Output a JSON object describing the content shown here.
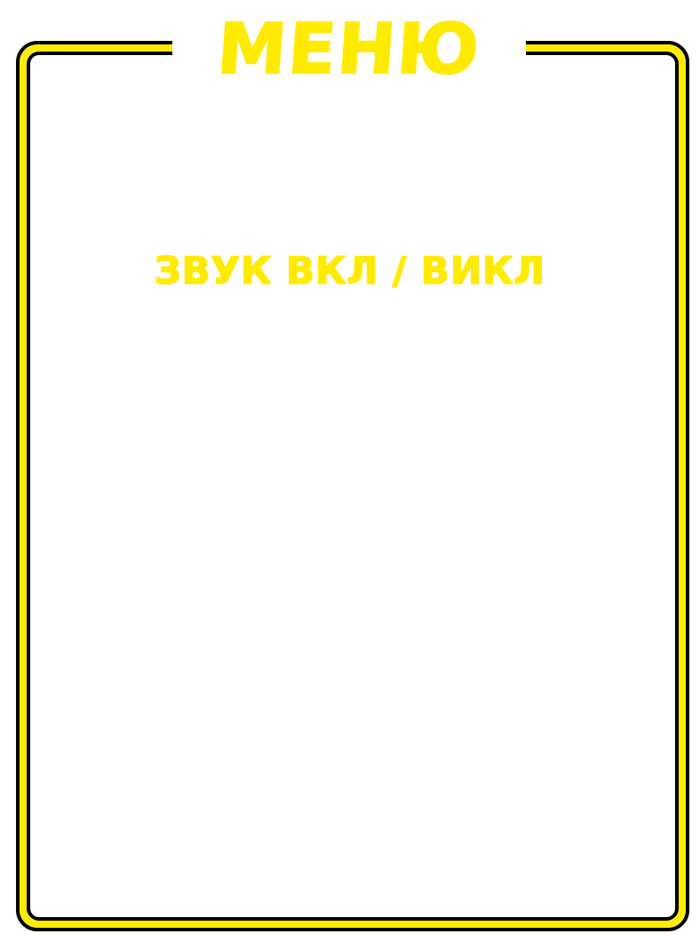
{
  "menu": {
    "title": "МЕНЮ",
    "items": [
      {
        "label": "ЗВУК ВКЛ / ВИКЛ"
      }
    ]
  },
  "colors": {
    "accent": "#FFEB00",
    "outline": "#000000",
    "background": "#FFFFFF"
  }
}
